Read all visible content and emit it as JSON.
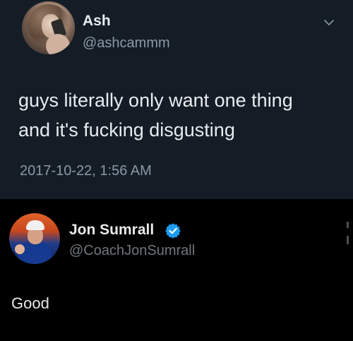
{
  "original_tweet": {
    "author_name": "Ash",
    "author_handle": "@ashcammm",
    "text_lines": [
      "guys literally only want one thing",
      "and it's fucking disgusting"
    ],
    "timestamp": "2017-10-22, 1:56 AM",
    "menu_icon": "chevron-down-icon",
    "background_color": "#141d26"
  },
  "reply_tweet": {
    "author_name": "Jon Sumrall",
    "author_handle": "@CoachJonSumrall",
    "verified": true,
    "verified_icon": "verified-badge-icon",
    "text": "Good",
    "background_color": "#000000",
    "accent_color": "#1d9bf0"
  }
}
